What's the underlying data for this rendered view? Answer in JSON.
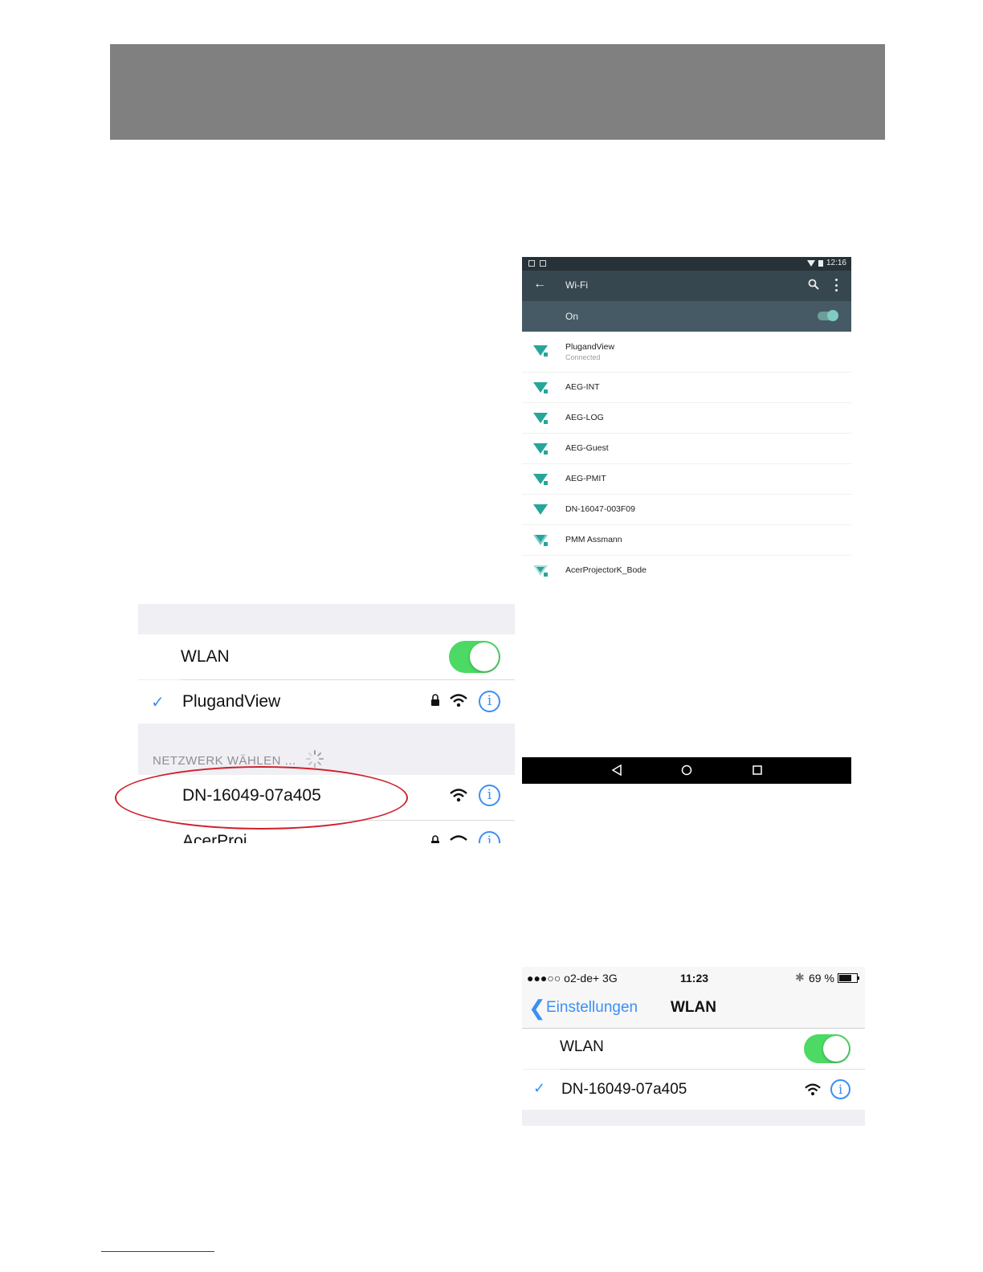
{
  "android": {
    "status_time": "12:16",
    "title": "Wi-Fi",
    "on_label": "On",
    "icons": [
      "back-arrow-icon",
      "search-icon",
      "more-vert-icon"
    ],
    "networks": [
      {
        "name": "PlugandView",
        "status": "Connected"
      },
      {
        "name": "AEG-INT"
      },
      {
        "name": "AEG-LOG"
      },
      {
        "name": "AEG-Guest"
      },
      {
        "name": "AEG-PMIT"
      },
      {
        "name": "DN-16047-003F09"
      },
      {
        "name": "PMM Assmann"
      },
      {
        "name": "AcerProjectorK_Bode"
      }
    ],
    "accent_color": "#26a69a"
  },
  "ios1": {
    "wlan_label": "WLAN",
    "connected_network": "PlugandView",
    "section_header": "NETZWERK WÄHLEN ...",
    "networks": [
      {
        "name": "DN-16049-07a405"
      },
      {
        "name": "AcerProj"
      }
    ]
  },
  "ios2": {
    "carrier": "●●●○○ o2-de+  3G",
    "time": "11:23",
    "battery": "69 %",
    "back_label": "Einstellungen",
    "nav_title": "WLAN",
    "wlan_label": "WLAN",
    "connected_network": "DN-16049-07a405"
  },
  "colors": {
    "ios_blue": "#3b8ff5",
    "ios_green": "#4cd964",
    "highlight_red": "#d0202a"
  }
}
